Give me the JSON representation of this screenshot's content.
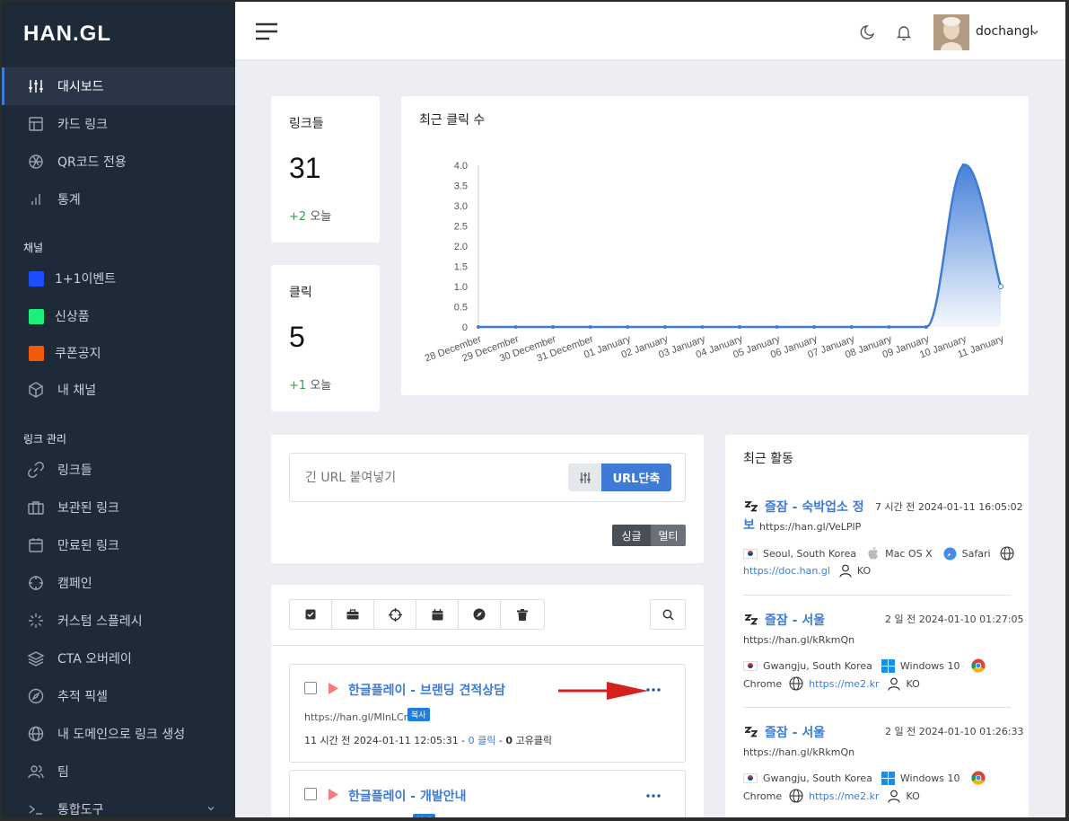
{
  "sidebar": {
    "logo": "HAN.GL",
    "main_items": [
      {
        "label": "대시보드",
        "icon": "sliders-icon"
      },
      {
        "label": "카드 링크",
        "icon": "layout-icon"
      },
      {
        "label": "QR코드 전용",
        "icon": "aperture-icon"
      },
      {
        "label": "통계",
        "icon": "bar-chart-icon"
      }
    ],
    "channels_heading": "채널",
    "channels": [
      {
        "label": "1+1이벤트",
        "color": "#1e4cff"
      },
      {
        "label": "신상품",
        "color": "#1bf07a"
      },
      {
        "label": "쿠폰공지",
        "color": "#f05a0a"
      },
      {
        "label": "내 채널",
        "icon": "box-icon"
      }
    ],
    "links_heading": "링크 관리",
    "link_items": [
      {
        "label": "링크들",
        "icon": "link-icon"
      },
      {
        "label": "보관된 링크",
        "icon": "briefcase-icon"
      },
      {
        "label": "만료된 링크",
        "icon": "calendar-icon"
      },
      {
        "label": "캠페인",
        "icon": "crosshair-icon"
      },
      {
        "label": "커스텀 스플레시",
        "icon": "loader-icon"
      },
      {
        "label": "CTA 오버레이",
        "icon": "layers-icon"
      },
      {
        "label": "추적 픽셀",
        "icon": "compass-icon"
      },
      {
        "label": "내 도메인으로 링크 생성",
        "icon": "globe-icon"
      },
      {
        "label": "팀",
        "icon": "users-icon"
      },
      {
        "label": "통합도구",
        "icon": "terminal-icon"
      }
    ]
  },
  "header": {
    "username": "dochangl"
  },
  "stats": {
    "links": {
      "title": "링크들",
      "value": "31",
      "delta": "+2",
      "delta_label": "오늘"
    },
    "clicks": {
      "title": "클릭",
      "value": "5",
      "delta": "+1",
      "delta_label": "오늘"
    }
  },
  "chart_data": {
    "type": "area",
    "title": "최근 클릭 수",
    "categories": [
      "28 December",
      "29 December",
      "30 December",
      "31 December",
      "01 January",
      "02 January",
      "03 January",
      "04 January",
      "05 January",
      "06 January",
      "07 January",
      "08 January",
      "09 January",
      "10 January",
      "11 January"
    ],
    "series": [
      {
        "values": [
          0,
          0,
          0,
          0,
          0,
          0,
          0,
          0,
          0,
          0,
          0,
          0,
          0,
          4,
          1
        ]
      }
    ],
    "y_ticks": [
      "4.0",
      "3.5",
      "3.0",
      "2.5",
      "2.0",
      "1.5",
      "1.0",
      "0.5",
      "0"
    ],
    "ylim": [
      0,
      4
    ],
    "grid": false,
    "color": "#3d7bd6"
  },
  "shortener": {
    "placeholder": "긴 URL 붙여넣기",
    "button": "URL단축",
    "mode_single": "싱글",
    "mode_multi": "멀티"
  },
  "links_list": [
    {
      "title": "한글플레이 - 브랜딩 견적상담",
      "short_url": "https://han.gl/MlnLCr",
      "copy_label": "복사",
      "time_ago": "11 시간 전",
      "date": "2024-01-11 12:05:31",
      "clicks": "0",
      "clicks_label": "클릭",
      "unique": "0",
      "unique_label": "고유클릭"
    },
    {
      "title": "한글플레이 - 개발안내",
      "copy_label": "복사"
    }
  ],
  "activity": {
    "title": "최근 활동",
    "items": [
      {
        "title": "즐잠 - 숙박업소 정보",
        "title_line1": "즐잠 - 숙박업소 정",
        "title_line2": "보",
        "short_url": "https://han.gl/VeLPlP",
        "time": "7 시간 전 2024-01-11 16:05:02",
        "location": "Seoul, South Korea",
        "os": "Mac OS X",
        "browser": "Safari",
        "referrer": "https://doc.han.gl",
        "lang": "KO"
      },
      {
        "title": "즐잠 - 서울",
        "short_url": "https://han.gl/kRkmQn",
        "time": "2 일 전 2024-01-10 01:27:05",
        "location": "Gwangju, South Korea",
        "os": "Windows 10",
        "browser": "Chrome",
        "referrer": "https://me2.kr",
        "lang": "KO"
      },
      {
        "title": "즐잠 - 서울",
        "short_url": "https://han.gl/kRkmQn",
        "time": "2 일 전 2024-01-10 01:26:33",
        "location": "Gwangju, South Korea",
        "os": "Windows 10",
        "browser": "Chrome",
        "referrer": "https://me2.kr",
        "lang": "KO"
      }
    ]
  }
}
